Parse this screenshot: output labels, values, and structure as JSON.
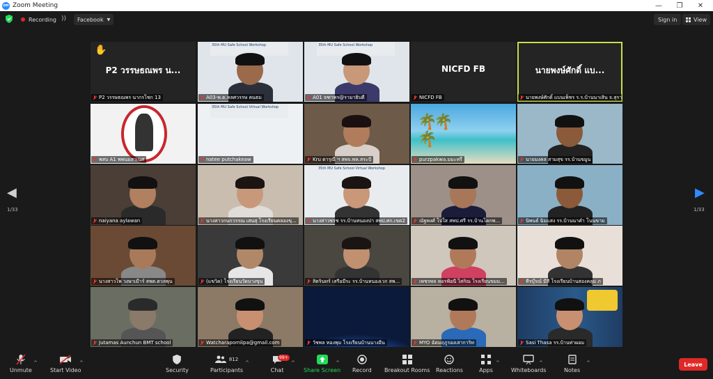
{
  "window": {
    "title": "Zoom Meeting",
    "controls": [
      "—",
      "❐",
      "✕"
    ]
  },
  "topbar": {
    "recording": "Recording",
    "stream": "Facebook",
    "signin": "Sign in",
    "view": "View"
  },
  "pagination": {
    "left": "1/33",
    "right": "1/33"
  },
  "tiles": [
    {
      "name": "P2 วรรษธณพร นากรโชก 13",
      "display": "P2 วรรษธณพร น...",
      "hand": "✋",
      "video": false,
      "bg": "#242424"
    },
    {
      "name": "A03-พ.ต.หลศวรรษ คนธม",
      "video": true,
      "bg": "#dfe5ea",
      "banner": "35th MU Safe School Workshop",
      "skin": "#9a6a4a",
      "shirt": "#2b2f3a",
      "hair": "#111"
    },
    {
      "name": "A01 จฑาพร@รามาธิบดี",
      "video": true,
      "bg": "#dfe5ea",
      "banner": "35th MU Safe School Workshop",
      "skin": "#c89878",
      "shirt": "#3c3a6a",
      "hair": "#111"
    },
    {
      "name": "NICFD FB",
      "display": "NICFD FB",
      "video": false,
      "bg": "#242424"
    },
    {
      "name": "นายพงษ์ศักดิ์ แบนเพ็ชร ร.ร.บ้านนาเสิน จ.สุรา...",
      "display": "นายพงษ์ศักดิ์ แบ...",
      "video": false,
      "bg": "#242424",
      "active": true
    },
    {
      "name": "พสบ A1 พพนมสาเนศ",
      "video": true,
      "bg": "#f2f2f2",
      "logo": true
    },
    {
      "name": "natee putchakeaw",
      "video": true,
      "bg": "#eef1f4",
      "banner": "35th MU Safe School Virtual Workshop"
    },
    {
      "name": "Kru ดารุณี ฯ สพจ.พห.สระปั",
      "video": true,
      "bg": "#6e5a48",
      "skin": "#b07c5c",
      "shirt": "#d8d0c8",
      "hair": "#1a1010"
    },
    {
      "name": "purzpakwa.มมะหรึ",
      "video": true,
      "bg": "#58b4d8",
      "beach": true
    },
    {
      "name": "นายมงคล สามสุข รร.บ้านขมูน",
      "video": true,
      "bg": "#9ab8c8",
      "skin": "#8a5a3a",
      "shirt": "#222",
      "hair": "#111"
    },
    {
      "name": "naiyana aylawan",
      "video": true,
      "bg": "#4a3e36",
      "skin": "#b08060",
      "shirt": "#2a2a2a",
      "hair": "#121010"
    },
    {
      "name": "นางสาวกนกวรรณ เสนสุ โรงเรียนคลองขุ...",
      "video": true,
      "bg": "#c9bdb0",
      "skin": "#c8987a",
      "shirt": "#e0dcd8",
      "hair": "#1a1412"
    },
    {
      "name": "นางสาวชรช รร.บ้านหนองปา สพป.ศก.เขต2",
      "video": true,
      "bg": "#e8ecef",
      "banner": "35th MU Safe School Virtual Workshop",
      "skin": "#c89878",
      "shirt": "#333",
      "hair": "#1a1412"
    },
    {
      "name": "ณัฐพงศ์ โปใส สพป.ศรี รร.บ้านโคกพ...",
      "video": true,
      "bg": "#9c9088",
      "skin": "#a87658",
      "shirt": "#1b1b3a",
      "hair": "#111"
    },
    {
      "name": "นิพนธ์ ฉิมแสง รร.บ้านนาคำ โนนขาม",
      "video": true,
      "bg": "#8ab0c6",
      "skin": "#8a5a3a",
      "shirt": "#222",
      "hair": "#111"
    },
    {
      "name": "นางสาวโพ วงษาเมืาร์ สพต.ตวลพุน",
      "video": true,
      "bg": "#6a4a34",
      "skin": "#a87a5a",
      "shirt": "#888",
      "hair": "#111"
    },
    {
      "name": "(แขวิด) โรงเรียนวัดบางขุน",
      "video": true,
      "bg": "#3a3a3a",
      "skin": "#b08868",
      "shirt": "#e6e6e6",
      "hair": "#111"
    },
    {
      "name": "สิตรินทร์ เสรีอมีระ รร.บ้านหนองเวก สพ...",
      "video": true,
      "bg": "#4a4640",
      "skin": "#c09070",
      "shirt": "#333",
      "hair": "#1a1412"
    },
    {
      "name": "เพชรพล หอรฟ้อนี ไสกิณ โรงเรียนขมม...",
      "video": true,
      "bg": "#cfc6bc",
      "skin": "#b07a5a",
      "shirt": "#d04060",
      "hair": "#111"
    },
    {
      "name": "ทีรบุ๊รณ์ มีสี โรงเรียนบ้านสองคลุม ภ",
      "video": true,
      "bg": "#e8e0d8",
      "skin": "#b08464",
      "shirt": "#333",
      "hair": "#111"
    },
    {
      "name": "Jutamas Aunchun BMT school",
      "video": true,
      "bg": "#6a6e62",
      "skin": "#8a7a6a",
      "shirt": "#555",
      "hair": "#2a2a2a"
    },
    {
      "name": "Watcharapornlipa@gmail.com",
      "video": true,
      "bg": "#8c7a66",
      "skin": "#c89070",
      "shirt": "#222",
      "hair": "#111"
    },
    {
      "name": "วัชพล ทองพุม โรงเรียนบ้านนางอีน",
      "video": true,
      "bg": "#0b1a3a",
      "earth": true
    },
    {
      "name": "MYO ฉัตมฤภูรองเสาการิท",
      "video": true,
      "bg": "#b8b0a0",
      "skin": "#b07a5a",
      "shirt": "#2a6ab8",
      "hair": "#111"
    },
    {
      "name": "Sasi Thasa รร.บ้านท่าผอม",
      "video": true,
      "bg": "#24405e",
      "skin": "#c89070",
      "shirt": "#2a2a2a",
      "hair": "#111",
      "poster": true
    }
  ],
  "toolbar": {
    "unmute": "Unmute",
    "start_video": "Start Video",
    "security": "Security",
    "participants": "Participants",
    "participants_count": "812",
    "chat": "Chat",
    "chat_badge": "99+",
    "share_screen": "Share Screen",
    "record": "Record",
    "breakout_rooms": "Breakout Rooms",
    "reactions": "Reactions",
    "apps": "Apps",
    "whiteboards": "Whiteboards",
    "notes": "Notes",
    "leave": "Leave"
  },
  "colors": {
    "accent": "#c8e04a",
    "share": "#23d959",
    "leave": "#e02828",
    "zoom": "#2d8cff"
  }
}
